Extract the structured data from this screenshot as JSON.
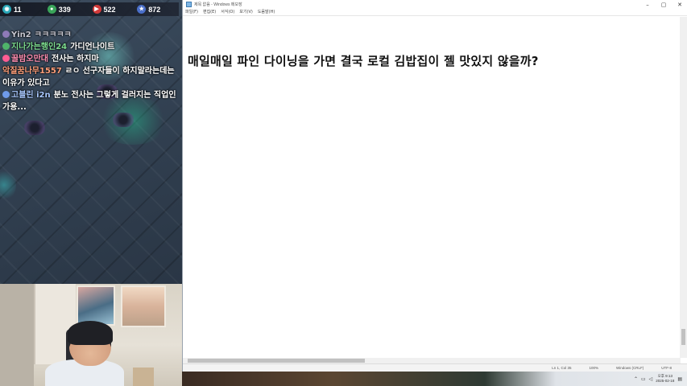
{
  "colors": {
    "chat_gray": "#c7c7d1",
    "chat_green": "#7ddc8f",
    "chat_pink": "#ff8fb3",
    "chat_orange": "#ff9f7a",
    "chat_blue": "#a9c8ff",
    "stat_teal": "#2aa7b8",
    "stat_green": "#3aa55a",
    "stat_red": "#d23a3a",
    "stat_blue": "#4a6fc9"
  },
  "stats": [
    {
      "icon": "viewer-icon",
      "value": "11"
    },
    {
      "icon": "follower-icon",
      "value": "339"
    },
    {
      "icon": "youtube-icon",
      "value": "522"
    },
    {
      "icon": "subscriber-icon",
      "value": "872"
    }
  ],
  "chat": [
    {
      "nick": "Yin2",
      "message": "ㅋㅋㅋㅋㅋ"
    },
    {
      "nick": "지나가는행인24",
      "message": "가디언나이트"
    },
    {
      "nick": "꿀밤오만대",
      "message": "전사는 하지마"
    },
    {
      "nick": "악질꿈나무1557",
      "message": "ㄹㅇ 선구자들이 하지말라는데는 이유가 있다고"
    },
    {
      "nick": "고블린 i2n",
      "message": "분노 전사는 그렇게 걸러지는 직업인가용..."
    }
  ],
  "notepad": {
    "title": "제목 없음 - Windows 메모장",
    "menu": [
      "파일(F)",
      "편집(E)",
      "서식(O)",
      "보기(V)",
      "도움말(H)"
    ],
    "text": "매일매일 파인 다이닝을 가면 결국 로컬 김밥집이 젤 맛있지 않을까?",
    "status": {
      "position": "Ln 1, Col 35",
      "zoom": "100%",
      "line_ending": "Windows (CRLF)",
      "encoding": "UTF-8"
    }
  },
  "tray": {
    "time": "오후 9:13",
    "date": "2025-02-18"
  }
}
